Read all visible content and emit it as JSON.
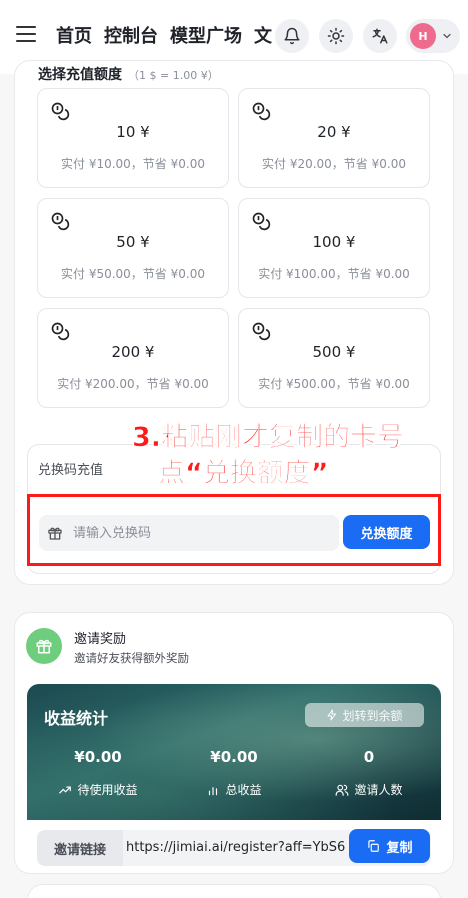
{
  "header": {
    "nav": [
      "首页",
      "控制台",
      "模型广场",
      "文"
    ],
    "avatar_initial": "H"
  },
  "recharge": {
    "section_title": "选择充值额度",
    "rate_note": "（1 $ = 1.00 ¥）",
    "options": [
      {
        "amount": "10 ¥",
        "note": "实付 ¥10.00，节省 ¥0.00"
      },
      {
        "amount": "20 ¥",
        "note": "实付 ¥20.00，节省 ¥0.00"
      },
      {
        "amount": "50 ¥",
        "note": "实付 ¥50.00，节省 ¥0.00"
      },
      {
        "amount": "100 ¥",
        "note": "实付 ¥100.00，节省 ¥0.00"
      },
      {
        "amount": "200 ¥",
        "note": "实付 ¥200.00，节省 ¥0.00"
      },
      {
        "amount": "500 ¥",
        "note": "实付 ¥500.00，节省 ¥0.00"
      }
    ]
  },
  "redeem": {
    "title": "兑换码充值",
    "placeholder": "请输入兑换码",
    "button": "兑换额度"
  },
  "annotation": {
    "line1": "3.粘贴刚才复制的卡号",
    "line2": "点“兑换额度”"
  },
  "invite": {
    "title": "邀请奖励",
    "subtitle": "邀请好友获得额外奖励",
    "earnings_title": "收益统计",
    "transfer_button": "划转到余额",
    "stats": [
      {
        "value": "¥0.00",
        "label": "待使用收益"
      },
      {
        "value": "¥0.00",
        "label": "总收益"
      },
      {
        "value": "0",
        "label": "邀请人数"
      }
    ],
    "link_label": "邀请链接",
    "link_value": "https://jimiai.ai/register?aff=YbS6",
    "copy_button": "复制"
  },
  "colors": {
    "primary": "#1a6cf5",
    "annotation": "#ff1a1a",
    "avatar": "#ee6b8e",
    "invite_icon": "#6fce7d"
  }
}
